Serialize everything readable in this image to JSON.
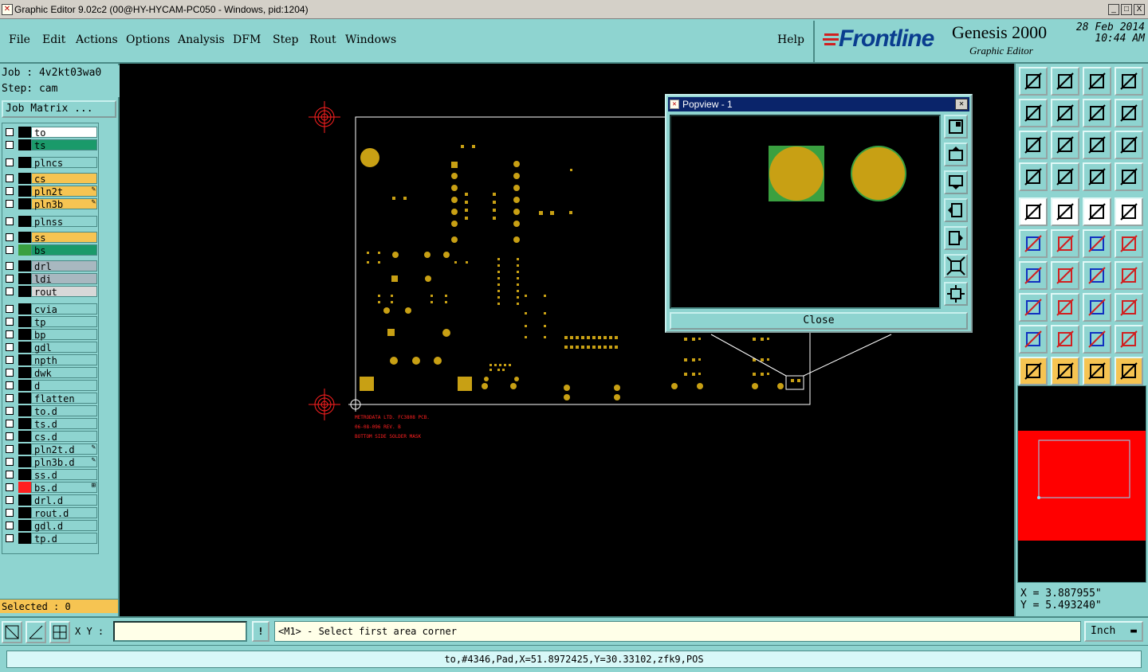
{
  "window": {
    "title": "Graphic Editor 9.02c2 (00@HY-HYCAM-PC050 - Windows, pid:1204)",
    "controls": [
      "_",
      "□",
      "X"
    ]
  },
  "menu": {
    "items": [
      "File",
      "Edit",
      "Actions",
      "Options",
      "Analysis",
      "DFM",
      "Step",
      "Rout",
      "Windows"
    ],
    "help": "Help"
  },
  "logo": {
    "brand": "Frontline",
    "product": "Genesis 2000",
    "subtitle": "Graphic Editor",
    "date": "28 Feb 2014",
    "time": "10:44 AM"
  },
  "job": {
    "job_line": "Job : 4v2kt03wa0",
    "step_line": "Step: cam",
    "matrix_button": "Job Matrix ..."
  },
  "layers": [
    {
      "name": "to",
      "color": "#ffffff",
      "swatch": "#000000",
      "mark": ""
    },
    {
      "name": "ts",
      "color": "#1a9a6a",
      "swatch": "#000000",
      "mark": ""
    },
    {
      "name": "plncs",
      "color": "#8ed4d0",
      "swatch": "#000000",
      "mark": ""
    },
    {
      "name": "cs",
      "color": "#f6c452",
      "swatch": "#000000",
      "mark": ""
    },
    {
      "name": "pln2t",
      "color": "#f6c452",
      "swatch": "#000000",
      "mark": "✎"
    },
    {
      "name": "pln3b",
      "color": "#f6c452",
      "swatch": "#000000",
      "mark": "✎"
    },
    {
      "name": "plnss",
      "color": "#8ed4d0",
      "swatch": "#000000",
      "mark": ""
    },
    {
      "name": "ss",
      "color": "#f6c452",
      "swatch": "#000000",
      "mark": ""
    },
    {
      "name": "bs",
      "color": "#1a9a6a",
      "swatch": "#3aa040",
      "mark": ""
    },
    {
      "name": "drl",
      "color": "#a8b8c0",
      "swatch": "#000000",
      "mark": ""
    },
    {
      "name": "ldi",
      "color": "#a8b8c0",
      "swatch": "#000000",
      "mark": ""
    },
    {
      "name": "rout",
      "color": "#d8d8d8",
      "swatch": "#000000",
      "mark": ""
    },
    {
      "name": "cvia",
      "color": "#8ed4d0",
      "swatch": "#000000",
      "mark": ""
    },
    {
      "name": "tp",
      "color": "#8ed4d0",
      "swatch": "#000000",
      "mark": ""
    },
    {
      "name": "bp",
      "color": "#8ed4d0",
      "swatch": "#000000",
      "mark": ""
    },
    {
      "name": "gdl",
      "color": "#8ed4d0",
      "swatch": "#000000",
      "mark": ""
    },
    {
      "name": "npth",
      "color": "#8ed4d0",
      "swatch": "#000000",
      "mark": ""
    },
    {
      "name": "dwk",
      "color": "#8ed4d0",
      "swatch": "#000000",
      "mark": ""
    },
    {
      "name": "d",
      "color": "#8ed4d0",
      "swatch": "#000000",
      "mark": ""
    },
    {
      "name": "flatten",
      "color": "#8ed4d0",
      "swatch": "#000000",
      "mark": ""
    },
    {
      "name": "to.d",
      "color": "#8ed4d0",
      "swatch": "#000000",
      "mark": ""
    },
    {
      "name": "ts.d",
      "color": "#8ed4d0",
      "swatch": "#000000",
      "mark": ""
    },
    {
      "name": "cs.d",
      "color": "#8ed4d0",
      "swatch": "#000000",
      "mark": ""
    },
    {
      "name": "pln2t.d",
      "color": "#8ed4d0",
      "swatch": "#000000",
      "mark": "✎"
    },
    {
      "name": "pln3b.d",
      "color": "#8ed4d0",
      "swatch": "#000000",
      "mark": "✎"
    },
    {
      "name": "ss.d",
      "color": "#8ed4d0",
      "swatch": "#000000",
      "mark": ""
    },
    {
      "name": "bs.d",
      "color": "#8ed4d0",
      "swatch": "#ff2020",
      "mark": "⊞"
    },
    {
      "name": "drl.d",
      "color": "#8ed4d0",
      "swatch": "#000000",
      "mark": ""
    },
    {
      "name": "rout.d",
      "color": "#8ed4d0",
      "swatch": "#000000",
      "mark": ""
    },
    {
      "name": "gdl.d",
      "color": "#8ed4d0",
      "swatch": "#000000",
      "mark": ""
    },
    {
      "name": "tp.d",
      "color": "#8ed4d0",
      "swatch": "#000000",
      "mark": ""
    }
  ],
  "selected": "Selected : 0",
  "board": {
    "silk_lines": [
      "METRODATA LTD. FC3808 PCB.",
      "06-08-096 REV. B",
      "BOTTOM SIDE SOLDER MASK"
    ],
    "pad_color": "#c8a014",
    "outline_color": "#ffffff",
    "fiducial_color": "#ff2020"
  },
  "popview": {
    "title": "Popview - 1",
    "close_label": "Close",
    "tools": [
      "zoom-fit-icon",
      "pan-up-icon",
      "pan-down-icon",
      "pan-left-icon",
      "pan-right-icon",
      "zoom-in-icon",
      "zoom-out-icon"
    ]
  },
  "toolbox": {
    "icons": [
      "zoom-home-icon",
      "zoom-back-icon",
      "zoom-home2-icon",
      "zoom-window-icon",
      "pan-left-icon",
      "pan-right-icon",
      "zoom-prev-icon",
      "redraw-icon",
      "zoom-fit-icon",
      "zoom-center-icon",
      "zoom-one-to-one-icon",
      "query-icon",
      "snap-icon",
      "grid-icon",
      "net-highlight-icon",
      "net-compare-icon",
      "pad-select-icon",
      "feature-select-icon",
      "ruler-icon",
      "fill-icon",
      "net-connect-icon",
      "cross-icon",
      "line-point-icon",
      "line-point2-icon",
      "angle-icon",
      "line-edit-icon",
      "arc-icon",
      "text-icon",
      "pad-add-icon",
      "line-break-icon",
      "measure-icon",
      "copy-icon",
      "triangle-icon",
      "triangle2-icon",
      "arc-tri-icon",
      "arc-tri2-icon",
      "pointer-icon",
      "pointer-select-icon",
      "pointer-rotate-icon",
      "pointer-route-icon"
    ]
  },
  "coords": {
    "x": "X = 3.887955\"",
    "y": "Y = 5.493240\""
  },
  "bottom": {
    "xy_label": "X Y :",
    "xy_value": "",
    "exclaim": "!",
    "prompt": "<M1> - Select first area corner",
    "units": "Inch"
  },
  "status": "to,#4346,Pad,X=51.8972425,Y=30.33102,zfk9,POS"
}
